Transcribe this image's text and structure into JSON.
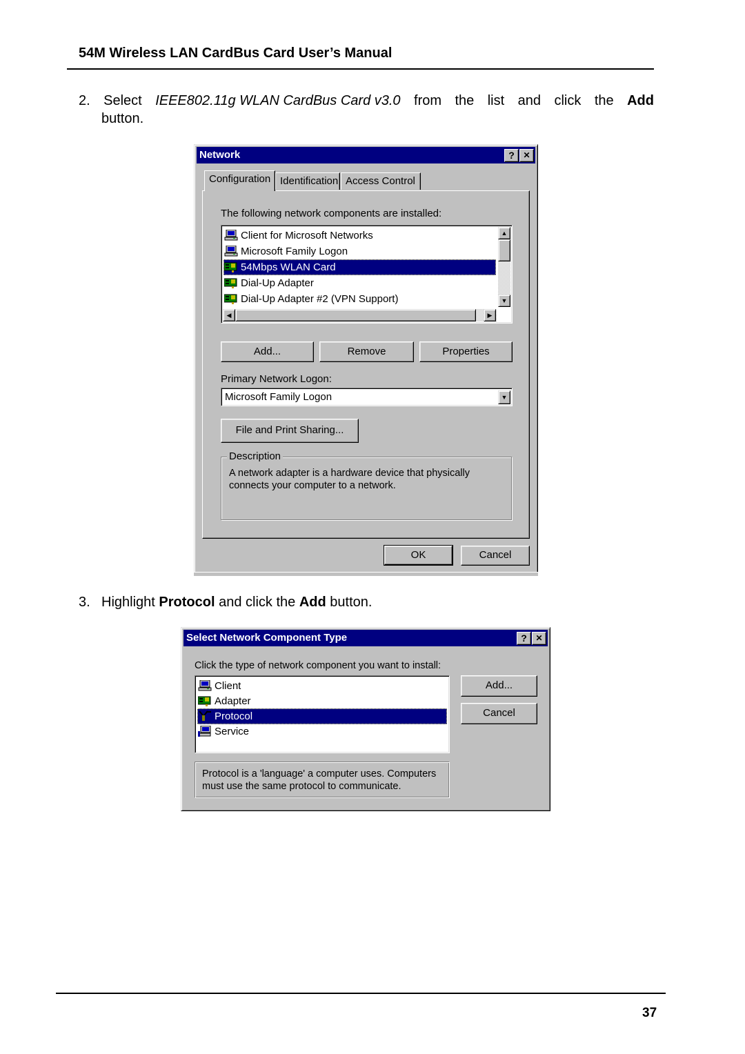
{
  "header": {
    "title": "54M Wireless LAN CardBus Card User’s Manual"
  },
  "steps": [
    {
      "number": "2.",
      "prefix": "Select ",
      "italic": "IEEE802.11g WLAN CardBus Card v3.0",
      "middle": " from the list and click the ",
      "bold": "Add",
      "suffix": "button."
    },
    {
      "number": "3.",
      "prefix": "Highlight ",
      "bold1": "Protocol",
      "middle": " and click the ",
      "bold2": "Add",
      "suffix": " button."
    }
  ],
  "network_dialog": {
    "title": "Network",
    "help_button": "?",
    "close_button": "✕",
    "tabs": [
      "Configuration",
      "Identification",
      "Access Control"
    ],
    "active_tab": "Configuration",
    "components_label": "The following network components are installed:",
    "components": [
      {
        "label": "Client for Microsoft Networks",
        "icon": "client-computer-icon",
        "selected": false
      },
      {
        "label": "Microsoft Family Logon",
        "icon": "client-computer-icon",
        "selected": false
      },
      {
        "label": "54Mbps WLAN Card",
        "icon": "network-adapter-icon",
        "selected": true
      },
      {
        "label": "Dial-Up Adapter",
        "icon": "network-adapter-icon",
        "selected": false
      },
      {
        "label": "Dial-Up Adapter #2 (VPN Support)",
        "icon": "network-adapter-icon",
        "selected": false
      }
    ],
    "buttons": {
      "add": "Add...",
      "remove": "Remove",
      "properties": "Properties"
    },
    "primary_logon_label": "Primary Network Logon:",
    "primary_logon_value": "Microsoft Family Logon",
    "file_print_button": "File and Print Sharing...",
    "description_legend": "Description",
    "description_text": "A network adapter is a hardware device that physically connects your computer to a network.",
    "ok_button": "OK",
    "cancel_button": "Cancel"
  },
  "select_dialog": {
    "title": "Select Network Component Type",
    "help_button": "?",
    "close_button": "✕",
    "prompt": "Click the type of network component you want to install:",
    "items": [
      {
        "label": "Client",
        "icon": "client-computer-icon",
        "selected": false
      },
      {
        "label": "Adapter",
        "icon": "network-adapter-icon",
        "selected": false
      },
      {
        "label": "Protocol",
        "icon": "protocol-icon",
        "selected": true
      },
      {
        "label": "Service",
        "icon": "service-icon",
        "selected": false
      }
    ],
    "add_button": "Add...",
    "cancel_button": "Cancel",
    "description_text": "Protocol is a 'language' a computer uses. Computers must use the same protocol to communicate."
  },
  "footer": {
    "page_number": "37"
  }
}
